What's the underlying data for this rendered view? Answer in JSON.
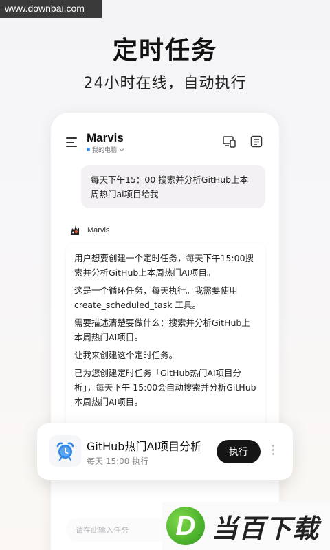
{
  "watermark": "www.downbai.com",
  "promo": {
    "headline": "定时任务",
    "subheadline": "24小时在线，自动执行"
  },
  "app": {
    "title": "Marvis",
    "device": "我的电脑",
    "accent": "#3b8bf5"
  },
  "icons": {
    "menu": "menu-icon",
    "device": "device-switch-icon",
    "notes": "notes-icon",
    "alarm": "alarm-clock-icon",
    "more": "more-vertical-icon",
    "dropdown": "chevron-down-icon"
  },
  "chat": {
    "user_message": "每天下午15：00 搜索并分析GitHub上本周热门ai项目给我",
    "bot_name": "Marvis",
    "bot_paragraphs": [
      "用户想要创建一个定时任务，每天下午15:00搜索并分析GitHub上本周热门AI项目。",
      "这是一个循环任务，每天执行。我需要使用create_scheduled_task 工具。",
      "需要描述清楚要做什么：搜索并分析GitHub上本周热门AI项目。",
      "让我来创建这个定时任务。",
      "已为您创建定时任务「GitHub热门AI项目分析」，每天下午 15:00会自动搜索并分析GitHub本周热门AI项目。"
    ]
  },
  "input": {
    "placeholder": "请在此输入任务"
  },
  "task_card": {
    "title": "GitHub热门AI项目分析",
    "schedule": "每天 15:00 执行",
    "run_label": "执行"
  },
  "logo": {
    "letter": "D",
    "text": "当百下载"
  }
}
